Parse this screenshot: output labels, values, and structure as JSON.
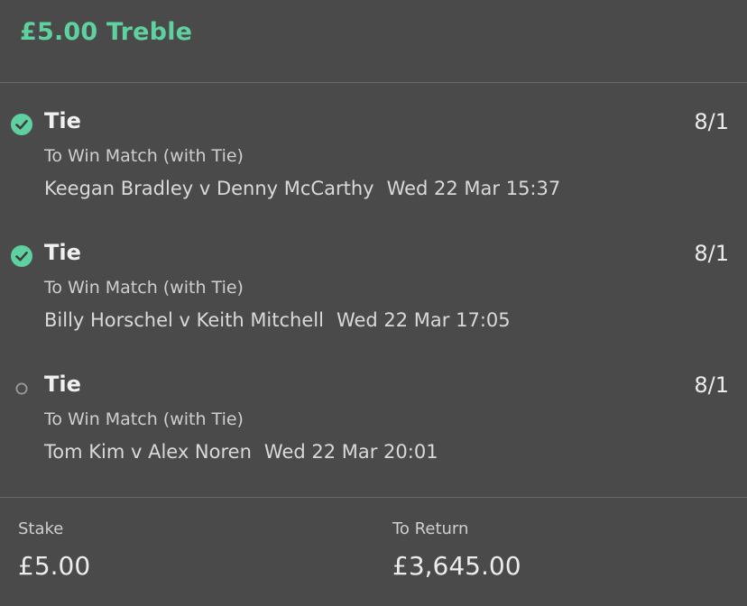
{
  "bet": {
    "title": "£5.00 Treble"
  },
  "colors": {
    "accent": "#5fd0a0",
    "background": "#4a4a4a"
  },
  "selections": [
    {
      "status": "won",
      "status_icon": "check-circle-icon",
      "name": "Tie",
      "odds": "8/1",
      "market": "To Win Match (with Tie)",
      "event": "Keegan Bradley v Denny McCarthy",
      "date": "Wed 22 Mar 15:37"
    },
    {
      "status": "won",
      "status_icon": "check-circle-icon",
      "name": "Tie",
      "odds": "8/1",
      "market": "To Win Match (with Tie)",
      "event": "Billy Horschel v Keith Mitchell",
      "date": "Wed 22 Mar 17:05"
    },
    {
      "status": "pending",
      "status_icon": "open-circle-icon",
      "name": "Tie",
      "odds": "8/1",
      "market": "To Win Match (with Tie)",
      "event": "Tom Kim v Alex Noren",
      "date": "Wed 22 Mar 20:01"
    }
  ],
  "footer": {
    "stake_label": "Stake",
    "stake_value": "£5.00",
    "return_label": "To Return",
    "return_value": "£3,645.00"
  }
}
